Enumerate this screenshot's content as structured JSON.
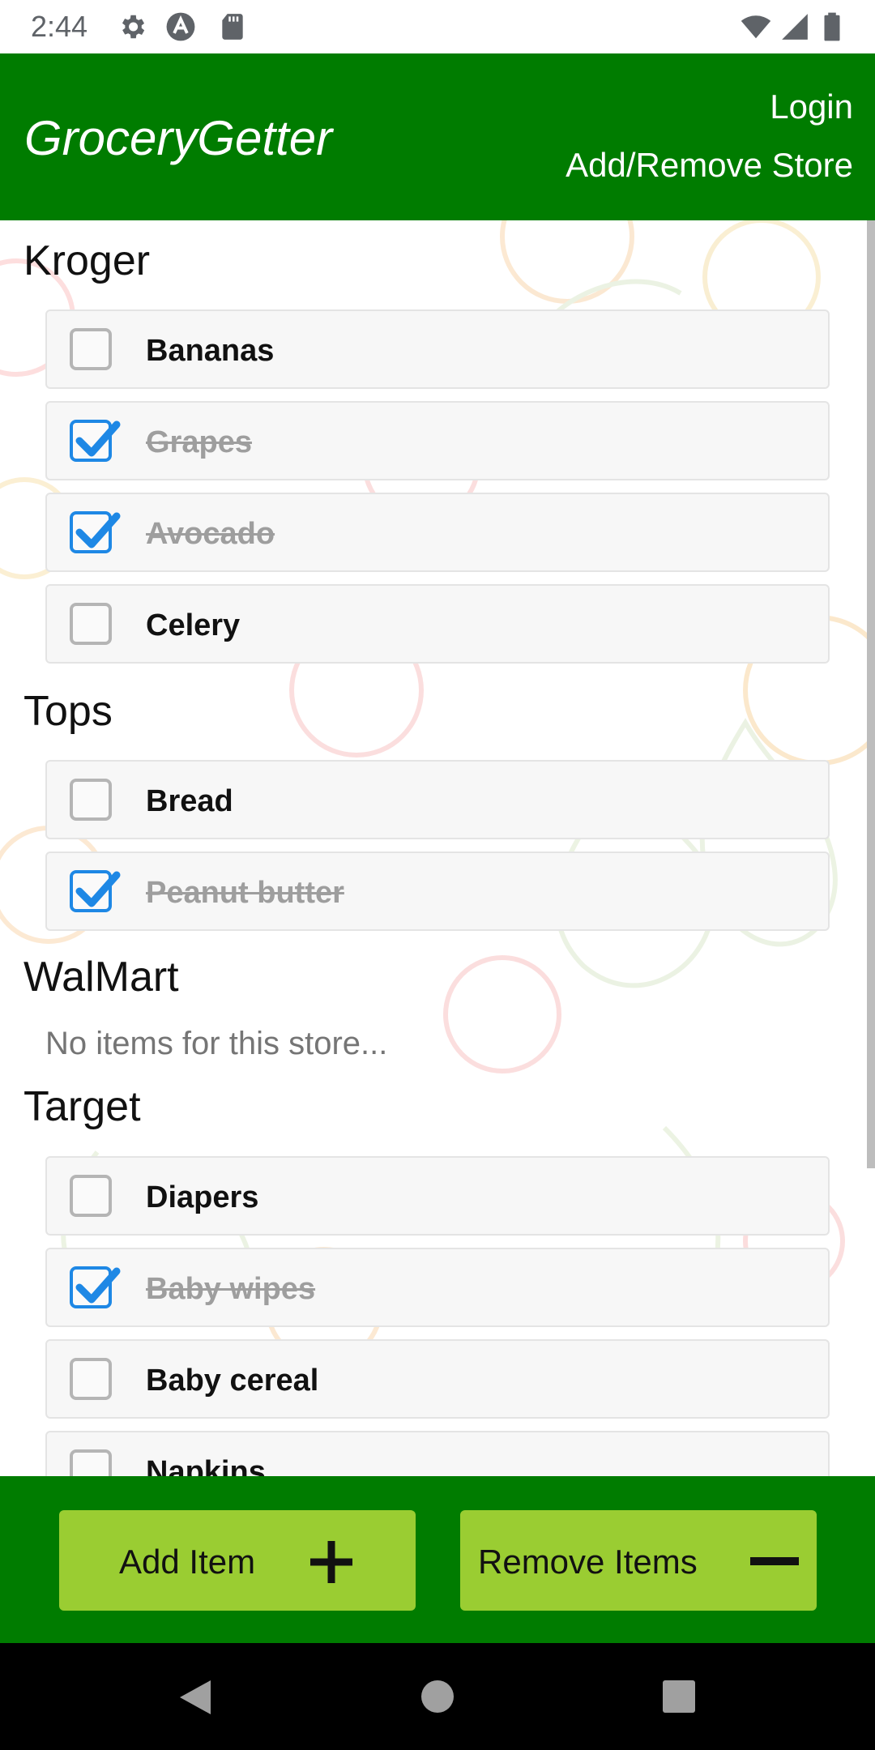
{
  "status_bar": {
    "time": "2:44",
    "icons": [
      "gear-icon",
      "vpn-icon",
      "sd-card-icon",
      "wifi-icon",
      "signal-icon",
      "battery-icon"
    ]
  },
  "header": {
    "title": "GroceryGetter",
    "login_label": "Login",
    "add_remove_store_label": "Add/Remove Store",
    "background_color": "#007c00"
  },
  "stores": [
    {
      "name": "Kroger",
      "items": [
        {
          "label": "Bananas",
          "checked": false
        },
        {
          "label": "Grapes",
          "checked": true
        },
        {
          "label": "Avocado",
          "checked": true
        },
        {
          "label": "Celery",
          "checked": false
        }
      ]
    },
    {
      "name": "Tops",
      "items": [
        {
          "label": "Bread",
          "checked": false
        },
        {
          "label": "Peanut butter",
          "checked": true
        }
      ]
    },
    {
      "name": "WalMart",
      "empty_message": "No items for this store...",
      "items": []
    },
    {
      "name": "Target",
      "items": [
        {
          "label": "Diapers",
          "checked": false
        },
        {
          "label": "Baby wipes",
          "checked": true
        },
        {
          "label": "Baby cereal",
          "checked": false
        },
        {
          "label": "Napkins",
          "checked": false
        }
      ]
    }
  ],
  "bottom_bar": {
    "add_item_label": "Add Item",
    "remove_items_label": "Remove Items",
    "button_color": "#9acd32"
  },
  "nav_bar": {
    "icons": [
      "back-icon",
      "home-icon",
      "recents-icon"
    ]
  },
  "colors": {
    "checkbox_checked": "#1e88e5",
    "checked_text": "#9e9e9e"
  }
}
